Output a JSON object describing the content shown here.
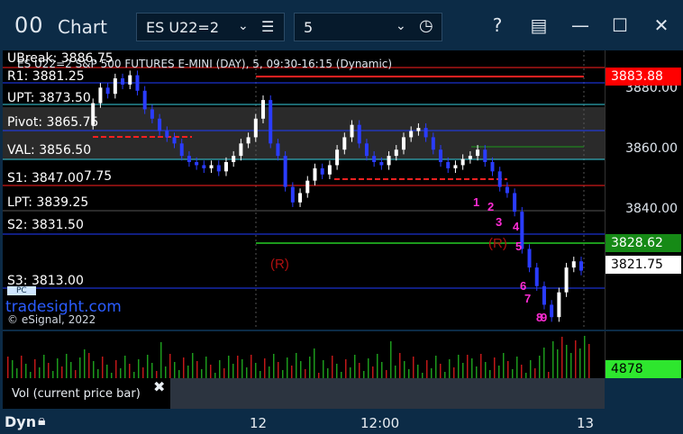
{
  "titlebar": {
    "icon": "00",
    "title": "Chart",
    "symbol": "ES U22=2",
    "interval": "5"
  },
  "chart": {
    "header": "ES U22=2 S&P 500 FUTURES E-MINI (DAY), 5, 09:30-16:15 (Dynamic)",
    "watermark": "tradesight.com",
    "copyright": "© eSignal, 2022",
    "levels": [
      {
        "label": "UBreak: 3886.75"
      },
      {
        "label": "R1: 3881.25"
      },
      {
        "label": "UPT: 3873.50"
      },
      {
        "label": "Pivot: 3865.75"
      },
      {
        "label": "VAL: 3856.50"
      },
      {
        "label": "S1: 3847.00"
      },
      {
        "label": "LPT: 3839.25"
      },
      {
        "label": "S2: 3831.50"
      },
      {
        "label": "S3: 3813.00"
      }
    ],
    "extra_label": "7.75",
    "r_marker": "(R)",
    "seq_magenta": [
      "1",
      "2",
      "3",
      "4",
      "5",
      "6",
      "7",
      "8",
      "9"
    ]
  },
  "axis": {
    "ticks": [
      "3880.00",
      "3860.00",
      "3840.00"
    ],
    "boxes": [
      {
        "value": "3883.88",
        "bg": "#ff0000",
        "fg": "#ffffff"
      },
      {
        "value": "3828.62",
        "bg": "#168a16",
        "fg": "#ffffff"
      },
      {
        "value": "3821.75",
        "bg": "#ffffff",
        "fg": "#000000"
      }
    ],
    "vol_value": "4878"
  },
  "volume": {
    "label": "Vol (current price bar)"
  },
  "timeaxis": {
    "dyn": "Dyn",
    "ticks": [
      "12",
      "12:00",
      "13"
    ]
  },
  "colors": {
    "candle_up": "#ffffff",
    "candle_down": "#2a3cff",
    "level_blue": "#1f3cff",
    "level_red": "#ff2020",
    "level_green": "#1c9a1c",
    "level_cyan": "#39d0e0",
    "seq_green": "#25c425",
    "seq_magenta": "#ff2cd4"
  },
  "chart_data": {
    "type": "candlestick",
    "ylim": [
      3802,
      3892
    ],
    "y_ticks": [
      3880,
      3860,
      3840
    ],
    "price_path": [
      3868,
      3875,
      3880,
      3878,
      3883,
      3881,
      3884,
      3879,
      3873,
      3870,
      3866,
      3864,
      3862,
      3858,
      3856,
      3855,
      3854,
      3855,
      3853,
      3856,
      3858,
      3862,
      3864,
      3870,
      3876,
      3862,
      3858,
      3848,
      3843,
      3846,
      3850,
      3854,
      3852,
      3855,
      3860,
      3864,
      3868,
      3862,
      3858,
      3856,
      3855,
      3858,
      3860,
      3864,
      3866,
      3867,
      3864,
      3860,
      3856,
      3854,
      3855,
      3857,
      3858,
      3860,
      3856,
      3853,
      3848,
      3846,
      3840,
      3828,
      3822,
      3816,
      3810,
      3806,
      3814,
      3822,
      3824,
      3821
    ]
  }
}
